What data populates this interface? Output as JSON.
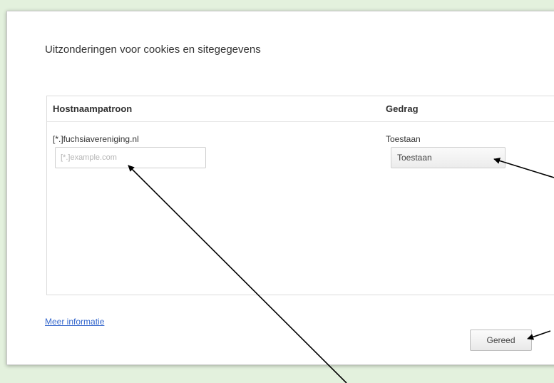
{
  "dialog": {
    "title": "Uitzonderingen voor cookies en sitegegevens"
  },
  "table": {
    "columns": {
      "host": "Hostnaampatroon",
      "behavior": "Gedrag"
    },
    "rows": [
      {
        "host": "[*.]fuchsiavereniging.nl",
        "behavior": "Toestaan"
      }
    ],
    "new_entry": {
      "host_placeholder": "[*.]example.com",
      "host_value": "",
      "behavior_selected": "Toestaan"
    }
  },
  "footer": {
    "more_info_link": "Meer informatie",
    "done_button": "Gereed"
  },
  "annotation": {
    "arrow_color": "#000000"
  }
}
